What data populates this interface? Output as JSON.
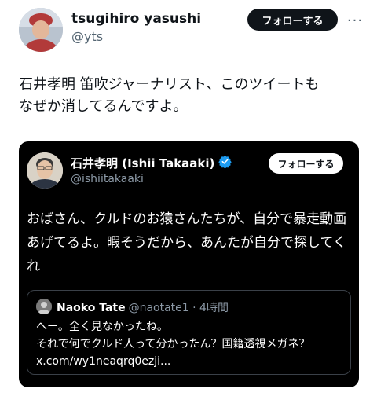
{
  "tweet": {
    "display_name": "tsugihiro yasushi",
    "handle": "@yts",
    "follow_label": "フォローする",
    "more_label": "···",
    "text_line1": "石井孝明 笛吹ジャーナリスト、このツイートも",
    "text_line2": "なぜか消してるんですよ。"
  },
  "quoted": {
    "display_name": "石井孝明 (Ishii Takaaki)",
    "handle": "@ishiitakaaki",
    "follow_label": "フォローする",
    "text_line1": "おばさん、クルドのお猿さんたちが、自分で暴走動画",
    "text_line2": "あげてるよ。暇そうだから、あんたが自分で探してく",
    "text_line3": "れ",
    "inner": {
      "display_name": "Naoko Tate",
      "meta": "@naotate1 · 4時間",
      "line1": "へー。全く見なかったね。",
      "line2": "それで何でクルド人って分かったん？国籍透視メガネ？",
      "line3": "x.com/wy1neaqrq0ezji..."
    }
  },
  "colors": {
    "text": "#0f1419",
    "secondary": "#536471",
    "quote_bg": "#000000",
    "verified": "#1d9bf0"
  }
}
